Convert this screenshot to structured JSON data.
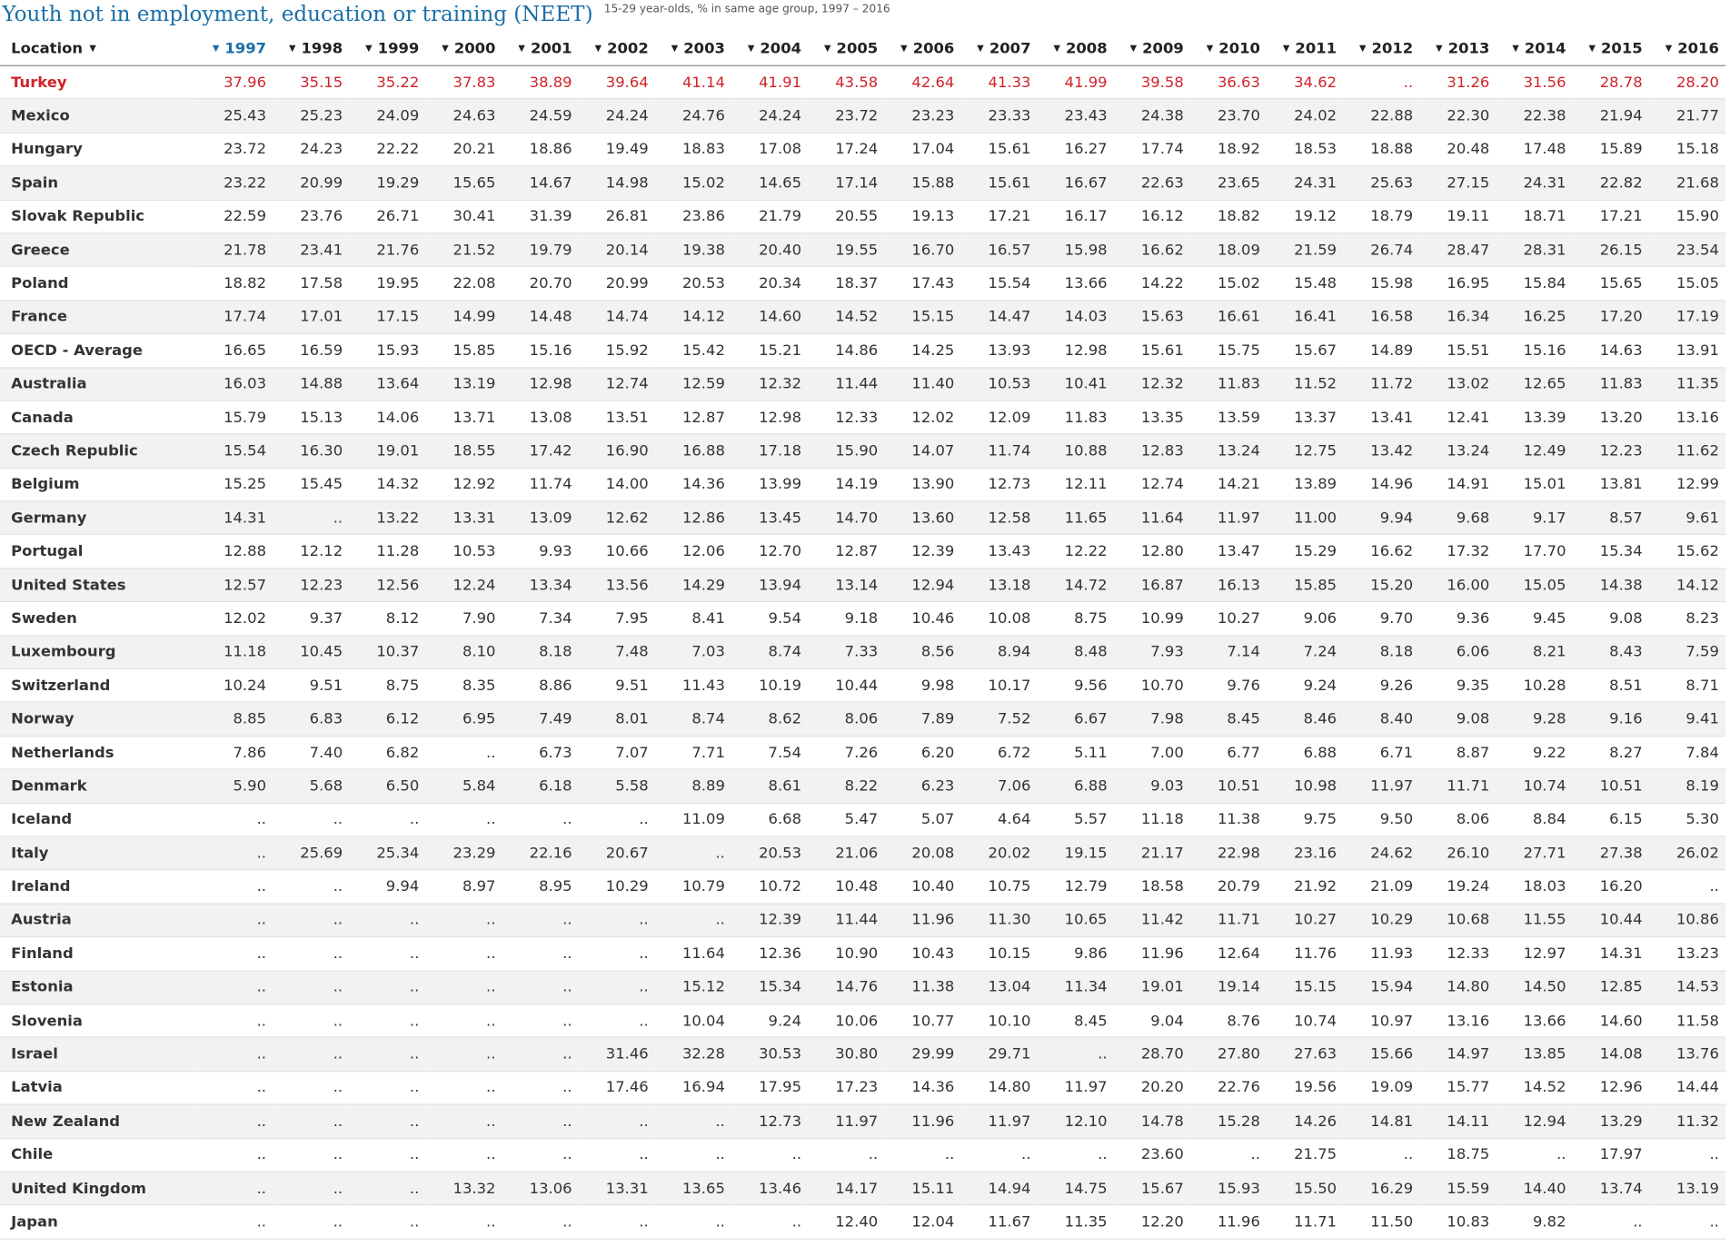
{
  "header": {
    "title": "Youth not in employment, education or training (NEET)",
    "subtitle": "15-29 year-olds, % in same age group, 1997 – 2016"
  },
  "colors": {
    "accent": "#1a6fa8",
    "highlight": "#d0232a",
    "row_alt": "#f2f2f2"
  },
  "icons": {
    "sort": "sort-caret-icon"
  },
  "chart_data": {
    "type": "table",
    "location_header": "Location",
    "sorted_column": "1997",
    "columns": [
      "1997",
      "1998",
      "1999",
      "2000",
      "2001",
      "2002",
      "2003",
      "2004",
      "2005",
      "2006",
      "2007",
      "2008",
      "2009",
      "2010",
      "2011",
      "2012",
      "2013",
      "2014",
      "2015",
      "2016"
    ],
    "highlighted_row": "Turkey",
    "rows": [
      {
        "location": "Turkey",
        "values": [
          "37.96",
          "35.15",
          "35.22",
          "37.83",
          "38.89",
          "39.64",
          "41.14",
          "41.91",
          "43.58",
          "42.64",
          "41.33",
          "41.99",
          "39.58",
          "36.63",
          "34.62",
          "..",
          "31.26",
          "31.56",
          "28.78",
          "28.20"
        ]
      },
      {
        "location": "Mexico",
        "values": [
          "25.43",
          "25.23",
          "24.09",
          "24.63",
          "24.59",
          "24.24",
          "24.76",
          "24.24",
          "23.72",
          "23.23",
          "23.33",
          "23.43",
          "24.38",
          "23.70",
          "24.02",
          "22.88",
          "22.30",
          "22.38",
          "21.94",
          "21.77"
        ]
      },
      {
        "location": "Hungary",
        "values": [
          "23.72",
          "24.23",
          "22.22",
          "20.21",
          "18.86",
          "19.49",
          "18.83",
          "17.08",
          "17.24",
          "17.04",
          "15.61",
          "16.27",
          "17.74",
          "18.92",
          "18.53",
          "18.88",
          "20.48",
          "17.48",
          "15.89",
          "15.18"
        ]
      },
      {
        "location": "Spain",
        "values": [
          "23.22",
          "20.99",
          "19.29",
          "15.65",
          "14.67",
          "14.98",
          "15.02",
          "14.65",
          "17.14",
          "15.88",
          "15.61",
          "16.67",
          "22.63",
          "23.65",
          "24.31",
          "25.63",
          "27.15",
          "24.31",
          "22.82",
          "21.68"
        ]
      },
      {
        "location": "Slovak Republic",
        "values": [
          "22.59",
          "23.76",
          "26.71",
          "30.41",
          "31.39",
          "26.81",
          "23.86",
          "21.79",
          "20.55",
          "19.13",
          "17.21",
          "16.17",
          "16.12",
          "18.82",
          "19.12",
          "18.79",
          "19.11",
          "18.71",
          "17.21",
          "15.90"
        ]
      },
      {
        "location": "Greece",
        "values": [
          "21.78",
          "23.41",
          "21.76",
          "21.52",
          "19.79",
          "20.14",
          "19.38",
          "20.40",
          "19.55",
          "16.70",
          "16.57",
          "15.98",
          "16.62",
          "18.09",
          "21.59",
          "26.74",
          "28.47",
          "28.31",
          "26.15",
          "23.54"
        ]
      },
      {
        "location": "Poland",
        "values": [
          "18.82",
          "17.58",
          "19.95",
          "22.08",
          "20.70",
          "20.99",
          "20.53",
          "20.34",
          "18.37",
          "17.43",
          "15.54",
          "13.66",
          "14.22",
          "15.02",
          "15.48",
          "15.98",
          "16.95",
          "15.84",
          "15.65",
          "15.05"
        ]
      },
      {
        "location": "France",
        "values": [
          "17.74",
          "17.01",
          "17.15",
          "14.99",
          "14.48",
          "14.74",
          "14.12",
          "14.60",
          "14.52",
          "15.15",
          "14.47",
          "14.03",
          "15.63",
          "16.61",
          "16.41",
          "16.58",
          "16.34",
          "16.25",
          "17.20",
          "17.19"
        ]
      },
      {
        "location": "OECD - Average",
        "values": [
          "16.65",
          "16.59",
          "15.93",
          "15.85",
          "15.16",
          "15.92",
          "15.42",
          "15.21",
          "14.86",
          "14.25",
          "13.93",
          "12.98",
          "15.61",
          "15.75",
          "15.67",
          "14.89",
          "15.51",
          "15.16",
          "14.63",
          "13.91"
        ]
      },
      {
        "location": "Australia",
        "values": [
          "16.03",
          "14.88",
          "13.64",
          "13.19",
          "12.98",
          "12.74",
          "12.59",
          "12.32",
          "11.44",
          "11.40",
          "10.53",
          "10.41",
          "12.32",
          "11.83",
          "11.52",
          "11.72",
          "13.02",
          "12.65",
          "11.83",
          "11.35"
        ]
      },
      {
        "location": "Canada",
        "values": [
          "15.79",
          "15.13",
          "14.06",
          "13.71",
          "13.08",
          "13.51",
          "12.87",
          "12.98",
          "12.33",
          "12.02",
          "12.09",
          "11.83",
          "13.35",
          "13.59",
          "13.37",
          "13.41",
          "12.41",
          "13.39",
          "13.20",
          "13.16"
        ]
      },
      {
        "location": "Czech Republic",
        "values": [
          "15.54",
          "16.30",
          "19.01",
          "18.55",
          "17.42",
          "16.90",
          "16.88",
          "17.18",
          "15.90",
          "14.07",
          "11.74",
          "10.88",
          "12.83",
          "13.24",
          "12.75",
          "13.42",
          "13.24",
          "12.49",
          "12.23",
          "11.62"
        ]
      },
      {
        "location": "Belgium",
        "values": [
          "15.25",
          "15.45",
          "14.32",
          "12.92",
          "11.74",
          "14.00",
          "14.36",
          "13.99",
          "14.19",
          "13.90",
          "12.73",
          "12.11",
          "12.74",
          "14.21",
          "13.89",
          "14.96",
          "14.91",
          "15.01",
          "13.81",
          "12.99"
        ]
      },
      {
        "location": "Germany",
        "values": [
          "14.31",
          "..",
          "13.22",
          "13.31",
          "13.09",
          "12.62",
          "12.86",
          "13.45",
          "14.70",
          "13.60",
          "12.58",
          "11.65",
          "11.64",
          "11.97",
          "11.00",
          "9.94",
          "9.68",
          "9.17",
          "8.57",
          "9.61"
        ]
      },
      {
        "location": "Portugal",
        "values": [
          "12.88",
          "12.12",
          "11.28",
          "10.53",
          "9.93",
          "10.66",
          "12.06",
          "12.70",
          "12.87",
          "12.39",
          "13.43",
          "12.22",
          "12.80",
          "13.47",
          "15.29",
          "16.62",
          "17.32",
          "17.70",
          "15.34",
          "15.62"
        ]
      },
      {
        "location": "United States",
        "values": [
          "12.57",
          "12.23",
          "12.56",
          "12.24",
          "13.34",
          "13.56",
          "14.29",
          "13.94",
          "13.14",
          "12.94",
          "13.18",
          "14.72",
          "16.87",
          "16.13",
          "15.85",
          "15.20",
          "16.00",
          "15.05",
          "14.38",
          "14.12"
        ]
      },
      {
        "location": "Sweden",
        "values": [
          "12.02",
          "9.37",
          "8.12",
          "7.90",
          "7.34",
          "7.95",
          "8.41",
          "9.54",
          "9.18",
          "10.46",
          "10.08",
          "8.75",
          "10.99",
          "10.27",
          "9.06",
          "9.70",
          "9.36",
          "9.45",
          "9.08",
          "8.23"
        ]
      },
      {
        "location": "Luxembourg",
        "values": [
          "11.18",
          "10.45",
          "10.37",
          "8.10",
          "8.18",
          "7.48",
          "7.03",
          "8.74",
          "7.33",
          "8.56",
          "8.94",
          "8.48",
          "7.93",
          "7.14",
          "7.24",
          "8.18",
          "6.06",
          "8.21",
          "8.43",
          "7.59"
        ]
      },
      {
        "location": "Switzerland",
        "values": [
          "10.24",
          "9.51",
          "8.75",
          "8.35",
          "8.86",
          "9.51",
          "11.43",
          "10.19",
          "10.44",
          "9.98",
          "10.17",
          "9.56",
          "10.70",
          "9.76",
          "9.24",
          "9.26",
          "9.35",
          "10.28",
          "8.51",
          "8.71"
        ]
      },
      {
        "location": "Norway",
        "values": [
          "8.85",
          "6.83",
          "6.12",
          "6.95",
          "7.49",
          "8.01",
          "8.74",
          "8.62",
          "8.06",
          "7.89",
          "7.52",
          "6.67",
          "7.98",
          "8.45",
          "8.46",
          "8.40",
          "9.08",
          "9.28",
          "9.16",
          "9.41"
        ]
      },
      {
        "location": "Netherlands",
        "values": [
          "7.86",
          "7.40",
          "6.82",
          "..",
          "6.73",
          "7.07",
          "7.71",
          "7.54",
          "7.26",
          "6.20",
          "6.72",
          "5.11",
          "7.00",
          "6.77",
          "6.88",
          "6.71",
          "8.87",
          "9.22",
          "8.27",
          "7.84"
        ]
      },
      {
        "location": "Denmark",
        "values": [
          "5.90",
          "5.68",
          "6.50",
          "5.84",
          "6.18",
          "5.58",
          "8.89",
          "8.61",
          "8.22",
          "6.23",
          "7.06",
          "6.88",
          "9.03",
          "10.51",
          "10.98",
          "11.97",
          "11.71",
          "10.74",
          "10.51",
          "8.19"
        ]
      },
      {
        "location": "Iceland",
        "values": [
          "..",
          "..",
          "..",
          "..",
          "..",
          "..",
          "11.09",
          "6.68",
          "5.47",
          "5.07",
          "4.64",
          "5.57",
          "11.18",
          "11.38",
          "9.75",
          "9.50",
          "8.06",
          "8.84",
          "6.15",
          "5.30"
        ]
      },
      {
        "location": "Italy",
        "values": [
          "..",
          "25.69",
          "25.34",
          "23.29",
          "22.16",
          "20.67",
          "..",
          "20.53",
          "21.06",
          "20.08",
          "20.02",
          "19.15",
          "21.17",
          "22.98",
          "23.16",
          "24.62",
          "26.10",
          "27.71",
          "27.38",
          "26.02"
        ]
      },
      {
        "location": "Ireland",
        "values": [
          "..",
          "..",
          "9.94",
          "8.97",
          "8.95",
          "10.29",
          "10.79",
          "10.72",
          "10.48",
          "10.40",
          "10.75",
          "12.79",
          "18.58",
          "20.79",
          "21.92",
          "21.09",
          "19.24",
          "18.03",
          "16.20",
          ".."
        ]
      },
      {
        "location": "Austria",
        "values": [
          "..",
          "..",
          "..",
          "..",
          "..",
          "..",
          "..",
          "12.39",
          "11.44",
          "11.96",
          "11.30",
          "10.65",
          "11.42",
          "11.71",
          "10.27",
          "10.29",
          "10.68",
          "11.55",
          "10.44",
          "10.86"
        ]
      },
      {
        "location": "Finland",
        "values": [
          "..",
          "..",
          "..",
          "..",
          "..",
          "..",
          "11.64",
          "12.36",
          "10.90",
          "10.43",
          "10.15",
          "9.86",
          "11.96",
          "12.64",
          "11.76",
          "11.93",
          "12.33",
          "12.97",
          "14.31",
          "13.23"
        ]
      },
      {
        "location": "Estonia",
        "values": [
          "..",
          "..",
          "..",
          "..",
          "..",
          "..",
          "15.12",
          "15.34",
          "14.76",
          "11.38",
          "13.04",
          "11.34",
          "19.01",
          "19.14",
          "15.15",
          "15.94",
          "14.80",
          "14.50",
          "12.85",
          "14.53"
        ]
      },
      {
        "location": "Slovenia",
        "values": [
          "..",
          "..",
          "..",
          "..",
          "..",
          "..",
          "10.04",
          "9.24",
          "10.06",
          "10.77",
          "10.10",
          "8.45",
          "9.04",
          "8.76",
          "10.74",
          "10.97",
          "13.16",
          "13.66",
          "14.60",
          "11.58"
        ]
      },
      {
        "location": "Israel",
        "values": [
          "..",
          "..",
          "..",
          "..",
          "..",
          "31.46",
          "32.28",
          "30.53",
          "30.80",
          "29.99",
          "29.71",
          "..",
          "28.70",
          "27.80",
          "27.63",
          "15.66",
          "14.97",
          "13.85",
          "14.08",
          "13.76"
        ]
      },
      {
        "location": "Latvia",
        "values": [
          "..",
          "..",
          "..",
          "..",
          "..",
          "17.46",
          "16.94",
          "17.95",
          "17.23",
          "14.36",
          "14.80",
          "11.97",
          "20.20",
          "22.76",
          "19.56",
          "19.09",
          "15.77",
          "14.52",
          "12.96",
          "14.44"
        ]
      },
      {
        "location": "New Zealand",
        "values": [
          "..",
          "..",
          "..",
          "..",
          "..",
          "..",
          "..",
          "12.73",
          "11.97",
          "11.96",
          "11.97",
          "12.10",
          "14.78",
          "15.28",
          "14.26",
          "14.81",
          "14.11",
          "12.94",
          "13.29",
          "11.32"
        ]
      },
      {
        "location": "Chile",
        "values": [
          "..",
          "..",
          "..",
          "..",
          "..",
          "..",
          "..",
          "..",
          "..",
          "..",
          "..",
          "..",
          "23.60",
          "..",
          "21.75",
          "..",
          "18.75",
          "..",
          "17.97",
          ".."
        ]
      },
      {
        "location": "United Kingdom",
        "values": [
          "..",
          "..",
          "..",
          "13.32",
          "13.06",
          "13.31",
          "13.65",
          "13.46",
          "14.17",
          "15.11",
          "14.94",
          "14.75",
          "15.67",
          "15.93",
          "15.50",
          "16.29",
          "15.59",
          "14.40",
          "13.74",
          "13.19"
        ]
      },
      {
        "location": "Japan",
        "values": [
          "..",
          "..",
          "..",
          "..",
          "..",
          "..",
          "..",
          "..",
          "12.40",
          "12.04",
          "11.67",
          "11.35",
          "12.20",
          "11.96",
          "11.71",
          "11.50",
          "10.83",
          "9.82",
          "..",
          ".."
        ]
      }
    ]
  }
}
